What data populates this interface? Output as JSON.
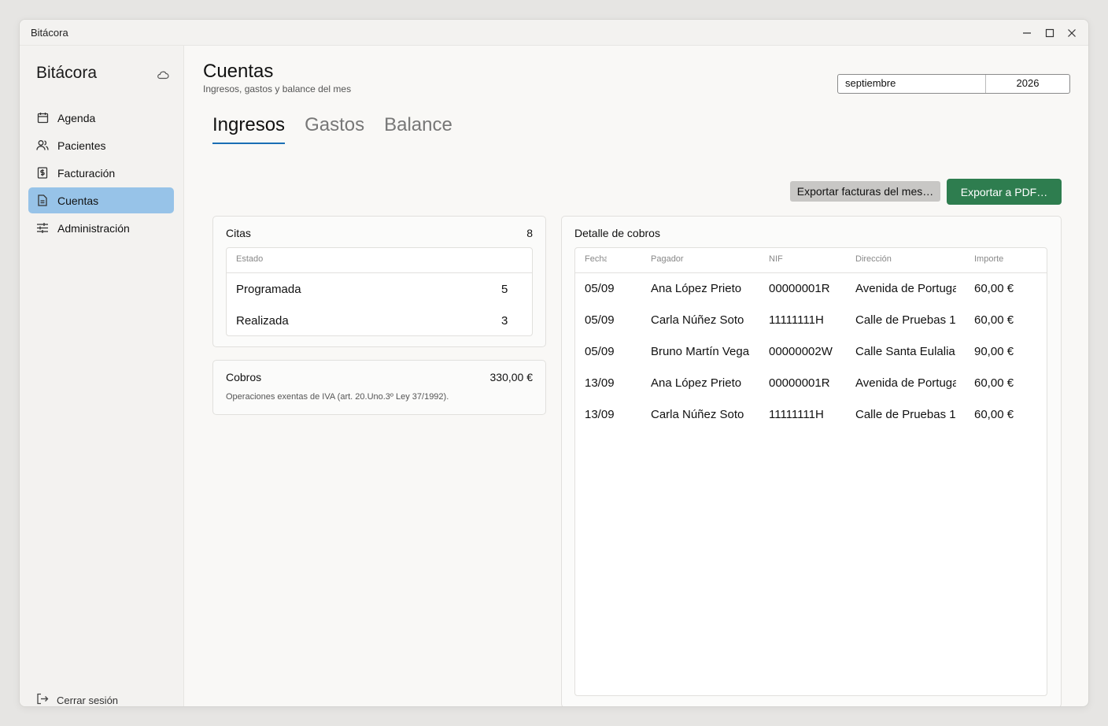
{
  "window": {
    "title": "Bitácora"
  },
  "sidebar": {
    "brand": "Bitácora",
    "items": [
      {
        "label": "Agenda",
        "icon": "calendar-icon",
        "active": false
      },
      {
        "label": "Pacientes",
        "icon": "users-icon",
        "active": false
      },
      {
        "label": "Facturación",
        "icon": "invoice-icon",
        "active": false
      },
      {
        "label": "Cuentas",
        "icon": "document-icon",
        "active": true
      },
      {
        "label": "Administración",
        "icon": "sliders-icon",
        "active": false
      }
    ],
    "logout": "Cerrar sesión"
  },
  "header": {
    "title": "Cuentas",
    "subtitle": "Ingresos, gastos y balance del mes",
    "month": "septiembre",
    "year": "2026"
  },
  "tabs": [
    "Ingresos",
    "Gastos",
    "Balance"
  ],
  "actions": {
    "export_invoices": "Exportar facturas del mes…",
    "export_pdf": "Exportar a PDF…"
  },
  "citas": {
    "title": "Citas",
    "total": "8",
    "column": "Estado",
    "rows": [
      {
        "estado": "Programada",
        "count": "5"
      },
      {
        "estado": "Realizada",
        "count": "3"
      }
    ]
  },
  "cobros": {
    "title": "Cobros",
    "total": "330,00 €",
    "note": "Operaciones exentas de IVA (art. 20.Uno.3º Ley 37/1992)."
  },
  "detalle": {
    "title": "Detalle de cobros",
    "columns": [
      "Fecha",
      "Pagador",
      "NIF",
      "Dirección",
      "Importe"
    ],
    "rows": [
      {
        "fecha": "05/09",
        "pagador": "Ana López Prieto",
        "nif": "00000001R",
        "direccion": "Avenida de Portugal",
        "importe": "60,00 €"
      },
      {
        "fecha": "05/09",
        "pagador": "Carla Núñez Soto",
        "nif": "11111111H",
        "direccion": "Calle de Pruebas 1",
        "importe": "60,00 €"
      },
      {
        "fecha": "05/09",
        "pagador": "Bruno Martín Vega",
        "nif": "00000002W",
        "direccion": "Calle Santa Eulalia",
        "importe": "90,00 €"
      },
      {
        "fecha": "13/09",
        "pagador": "Ana López Prieto",
        "nif": "00000001R",
        "direccion": "Avenida de Portugal",
        "importe": "60,00 €"
      },
      {
        "fecha": "13/09",
        "pagador": "Carla Núñez Soto",
        "nif": "11111111H",
        "direccion": "Calle de Pruebas 1",
        "importe": "60,00 €"
      }
    ]
  },
  "colors": {
    "accent": "#1a6fb5",
    "active_nav": "#97c3e8",
    "export_pdf": "#2e7d4f"
  }
}
